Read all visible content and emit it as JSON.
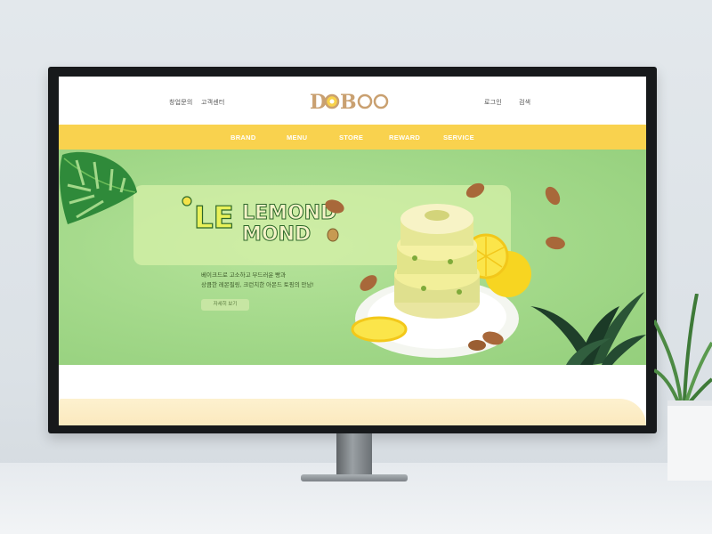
{
  "header": {
    "left_links": [
      {
        "label": "창업문의"
      },
      {
        "label": "고객센터"
      }
    ],
    "logo_text": "DOBOO",
    "right_links": [
      {
        "label": "로그인"
      },
      {
        "label": "검색"
      }
    ]
  },
  "nav": {
    "items": [
      {
        "label": "BRAND"
      },
      {
        "label": "MENU"
      },
      {
        "label": "STORE"
      },
      {
        "label": "REWARD"
      },
      {
        "label": "SERVICE"
      }
    ]
  },
  "hero": {
    "title_line1": "LEMOND",
    "title_line2": "MOND",
    "description_line1": "베이크드로 고소하고 부드러운 빵과",
    "description_line2": "상큼한 레몬필링, 크런치한 아몬드 토핑의 만남!",
    "cta_label": "자세히 보기"
  },
  "colors": {
    "nav_yellow": "#f9d24e",
    "hero_green": "#a2d889",
    "logo_brown": "#c9a070",
    "accent_yellow": "#f8d24a"
  }
}
